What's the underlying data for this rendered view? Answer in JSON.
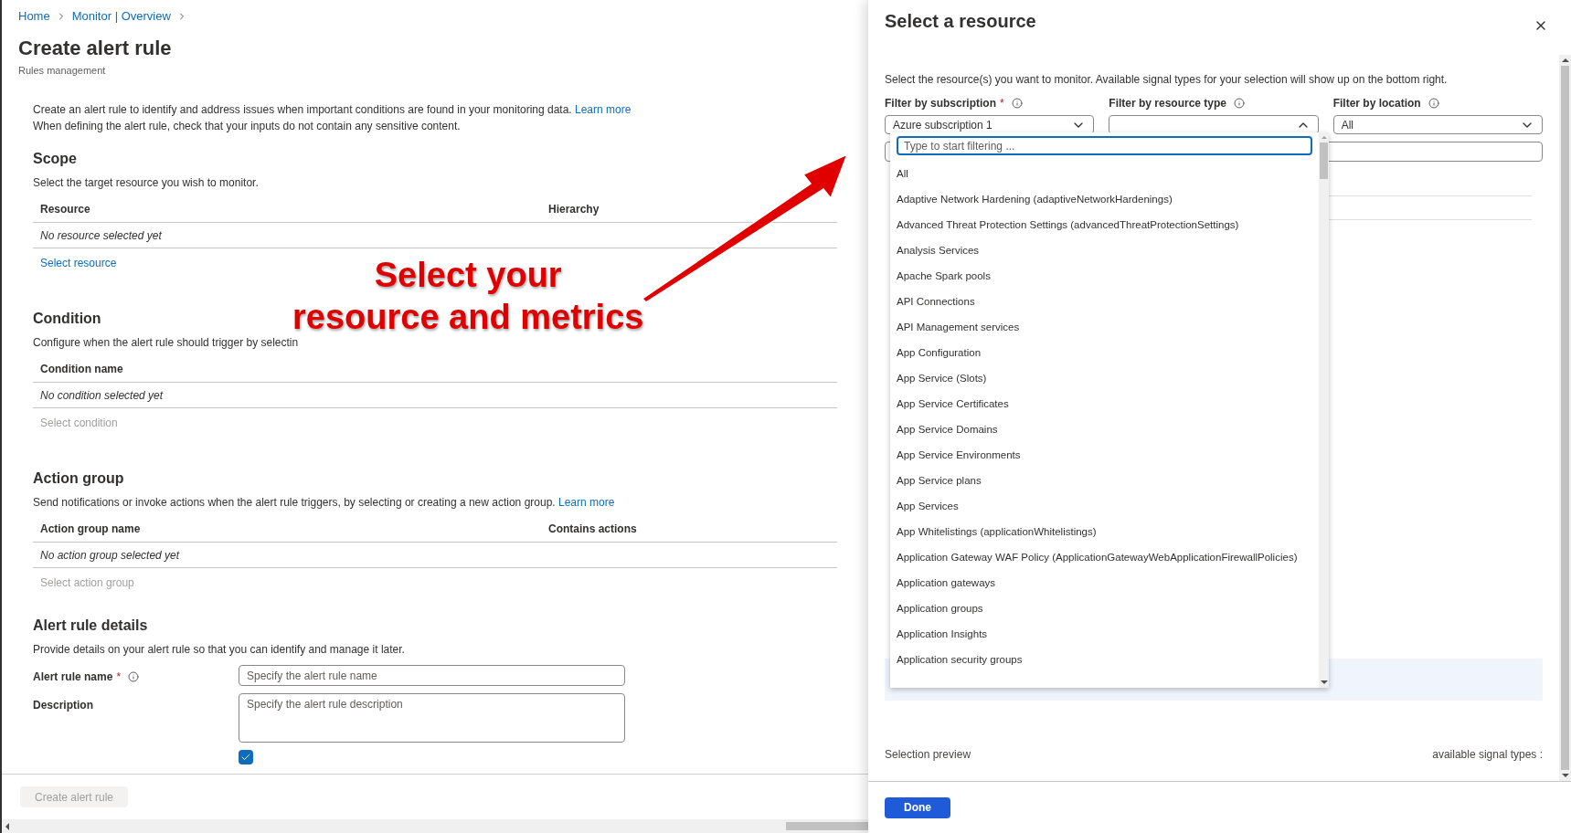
{
  "breadcrumb": [
    {
      "label": "Home"
    },
    {
      "label": "Monitor | Overview"
    }
  ],
  "page": {
    "title": "Create alert rule",
    "subtitle": "Rules management"
  },
  "intro": {
    "text": "Create an alert rule to identify and address issues when important conditions are found in your monitoring data.",
    "link": "Learn more",
    "note": "When defining the alert rule, check that your inputs do not contain any sensitive content."
  },
  "sections": [
    {
      "heading": "Scope",
      "description": "Select the target resource you wish to monitor.",
      "columns": [
        "Resource",
        "Hierarchy"
      ],
      "empty": "No resource selected yet",
      "action": "Select resource",
      "action_disabled": false
    },
    {
      "heading": "Condition",
      "description": "Configure when the alert rule should trigger by selectin",
      "columns": [
        "Condition name"
      ],
      "empty": "No condition selected yet",
      "action": "Select condition",
      "action_disabled": true
    },
    {
      "heading": "Action group",
      "description": "Send notifications or invoke actions when the alert rule triggers, by selecting or creating a new action group.",
      "link": "Learn more",
      "columns": [
        "Action group name",
        "Contains actions"
      ],
      "empty": "No action group selected yet",
      "action": "Select action group",
      "action_disabled": true
    }
  ],
  "details": {
    "heading": "Alert rule details",
    "description": "Provide details on your alert rule so that you can identify and manage it later.",
    "fields": [
      {
        "kind": "input",
        "label": "Alert rule name",
        "required_mark": "*",
        "info": true,
        "placeholder": "Specify the alert rule name"
      },
      {
        "kind": "textarea",
        "label": "Description",
        "info": false,
        "placeholder": "Specify the alert rule description"
      }
    ],
    "enable_checkbox": {
      "checked": true
    }
  },
  "footer": {
    "button": "Create alert rule",
    "disabled": true
  },
  "annotation": {
    "lines": [
      "Select your",
      "resource and metrics"
    ]
  },
  "panel": {
    "title": "Select a resource",
    "description": "Select the resource(s) you want to monitor. Available signal types for your selection will show up on the bottom right.",
    "filters": [
      {
        "label": "Filter by subscription",
        "required_mark": "*",
        "value": "Azure subscription 1",
        "open": false
      },
      {
        "label": "Filter by resource type",
        "open": true
      },
      {
        "label": "Filter by location",
        "value": "All",
        "open": false
      }
    ],
    "dropdown": {
      "placeholder": "Type to start filtering ...",
      "items": [
        "All",
        "Adaptive Network Hardening (adaptiveNetworkHardenings)",
        "Advanced Threat Protection Settings (advancedThreatProtectionSettings)",
        "Analysis Services",
        "Apache Spark pools",
        "API Connections",
        "API Management services",
        "App Configuration",
        "App Service (Slots)",
        "App Service Certificates",
        "App Service Domains",
        "App Service Environments",
        "App Service plans",
        "App Services",
        "App Whitelistings (applicationWhitelistings)",
        "Application Gateway WAF Policy (ApplicationGatewayWebApplicationFirewallPolicies)",
        "Application gateways",
        "Application groups",
        "Application Insights",
        "Application security groups"
      ]
    },
    "preview_label": "Selection preview",
    "signal_label": "available signal types :",
    "done": "Done"
  }
}
